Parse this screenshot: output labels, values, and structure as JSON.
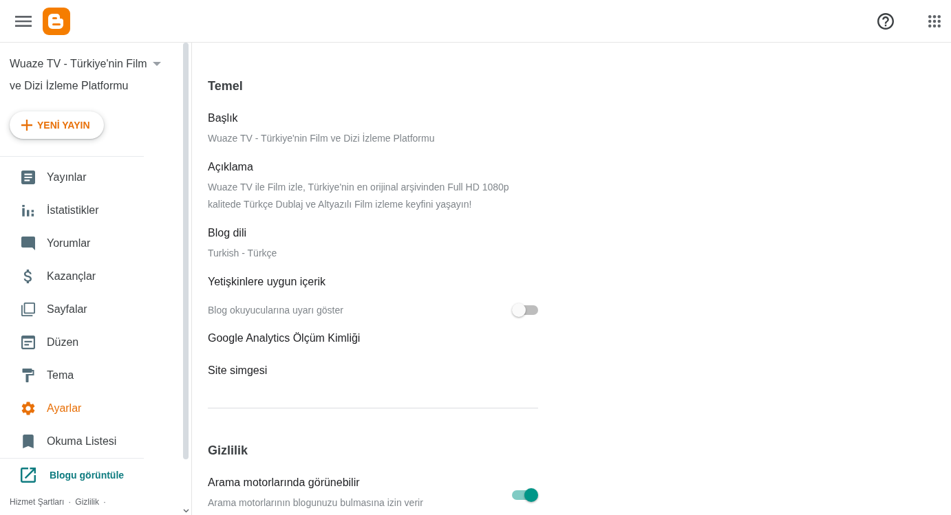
{
  "sidebar": {
    "blog_title": "Wuaze TV - Türkiye'nin Film ve Dizi İzleme Platformu",
    "new_post_button": "YENİ YAYIN",
    "items": [
      {
        "label": "Yayınlar",
        "selected": false
      },
      {
        "label": "İstatistikler",
        "selected": false
      },
      {
        "label": "Yorumlar",
        "selected": false
      },
      {
        "label": "Kazançlar",
        "selected": false
      },
      {
        "label": "Sayfalar",
        "selected": false
      },
      {
        "label": "Düzen",
        "selected": false
      },
      {
        "label": "Tema",
        "selected": false
      },
      {
        "label": "Ayarlar",
        "selected": true
      },
      {
        "label": "Okuma Listesi",
        "selected": false
      }
    ],
    "view_blog_link": "Blogu görüntüle",
    "footer": {
      "links": [
        "Hizmet Şartları",
        "Gizlilik"
      ],
      "separator": "·"
    }
  },
  "sections": [
    {
      "title": "Temel",
      "settings": [
        {
          "kind": "text",
          "label": "Başlık",
          "value": "Wuaze TV - Türkiye'nin Film ve Dizi İzleme Platformu"
        },
        {
          "kind": "text",
          "label": "Açıklama",
          "value": "Wuaze TV ile Film izle, Türkiye'nin en orijinal arşivinden Full HD 1080p kalitede Türkçe Dublaj ve Altyazılı Film izleme keyfini yaşayın!"
        },
        {
          "kind": "text",
          "label": "Blog dili",
          "value": "Turkish - Türkçe"
        },
        {
          "kind": "toggle_row",
          "label": "Yetişkinlere uygun içerik",
          "description": "Blog okuyucularına uyarı göster",
          "on": false
        },
        {
          "kind": "label",
          "label": "Google Analytics Ölçüm Kimliği"
        },
        {
          "kind": "label",
          "label": "Site simgesi"
        }
      ]
    },
    {
      "title": "Gizlilik",
      "settings": [
        {
          "kind": "toggle",
          "label": "Arama motorlarında görünebilir",
          "description": "Arama motorlarının blogunuzu bulmasına izin verir",
          "on": true
        }
      ]
    }
  ]
}
